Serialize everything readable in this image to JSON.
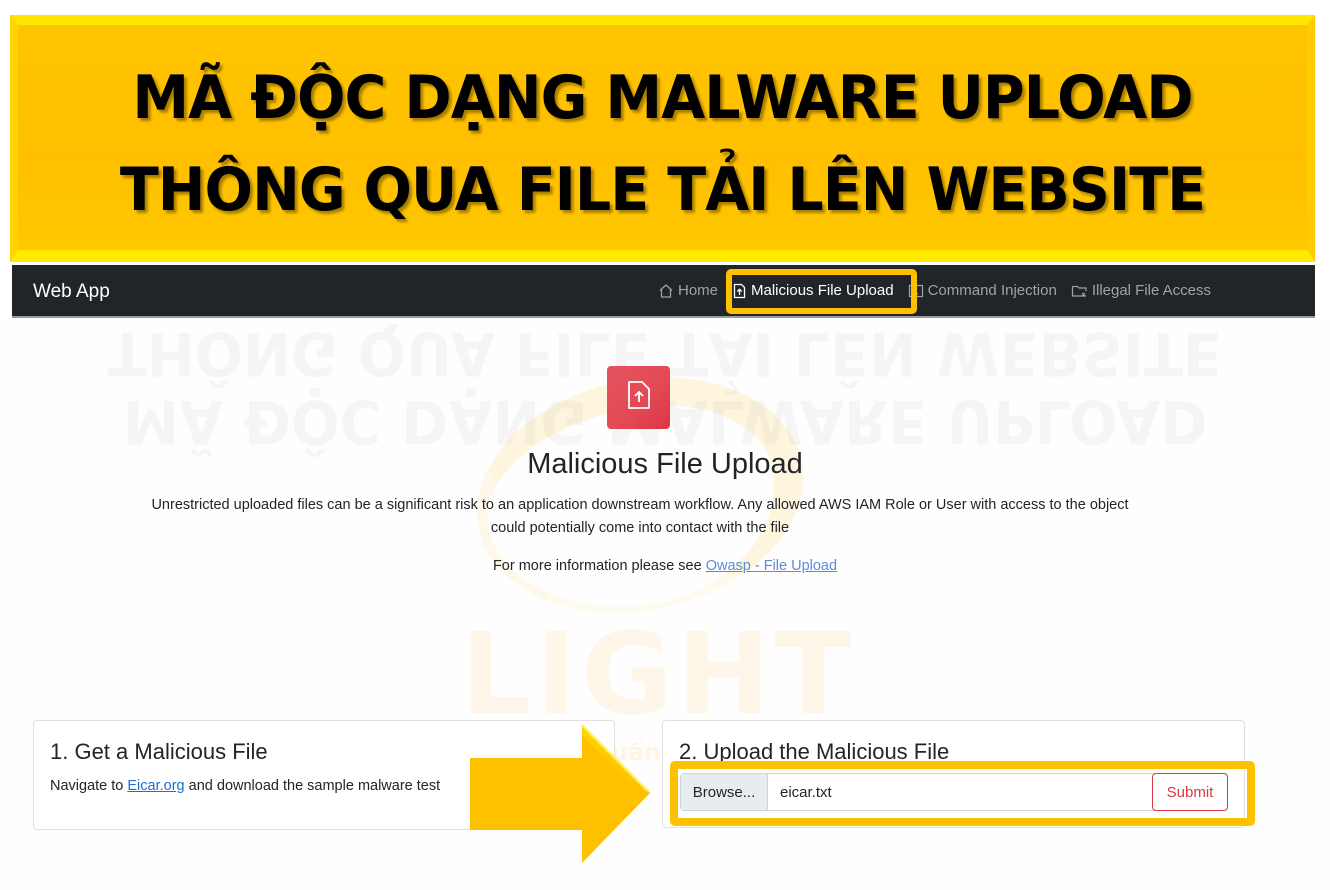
{
  "banner": {
    "line1": "MÃ ĐỘC DẠNG MALWARE UPLOAD",
    "line2": "THÔNG QUA FILE TẢI LÊN WEBSITE",
    "color": "#ffc000"
  },
  "navbar": {
    "brand": "Web App",
    "items": [
      {
        "label": "Home",
        "icon": "home-icon",
        "active": false
      },
      {
        "label": "Malicious File Upload",
        "icon": "file-upload-icon",
        "active": true
      },
      {
        "label": "Command Injection",
        "icon": "terminal-icon",
        "active": false
      },
      {
        "label": "Illegal File Access",
        "icon": "folder-x-icon",
        "active": false
      }
    ]
  },
  "hero": {
    "icon": "file-upload-icon",
    "icon_color": "#dc3545",
    "title": "Malicious File Upload",
    "description": "Unrestricted uploaded files can be a significant risk to an application downstream workflow. Any allowed AWS IAM Role or User with access to the object could potentially come into contact with the file",
    "more_prefix": "For more information please see ",
    "more_link": "Owasp - File Upload"
  },
  "watermark": {
    "text": "LIGHT",
    "subtext": "Nhanh - Chuẩn"
  },
  "cards": [
    {
      "title": "1. Get a Malicious File",
      "text_prefix": "Navigate to ",
      "link": "Eicar.org",
      "text_suffix": " and download the sample malware test"
    },
    {
      "title": "2. Upload the Malicious File",
      "browse_label": "Browse...",
      "file_name": "eicar.txt",
      "submit_label": "Submit"
    }
  ],
  "annotation": {
    "highlight_color": "#ffc000",
    "arrow": "right-arrow"
  }
}
